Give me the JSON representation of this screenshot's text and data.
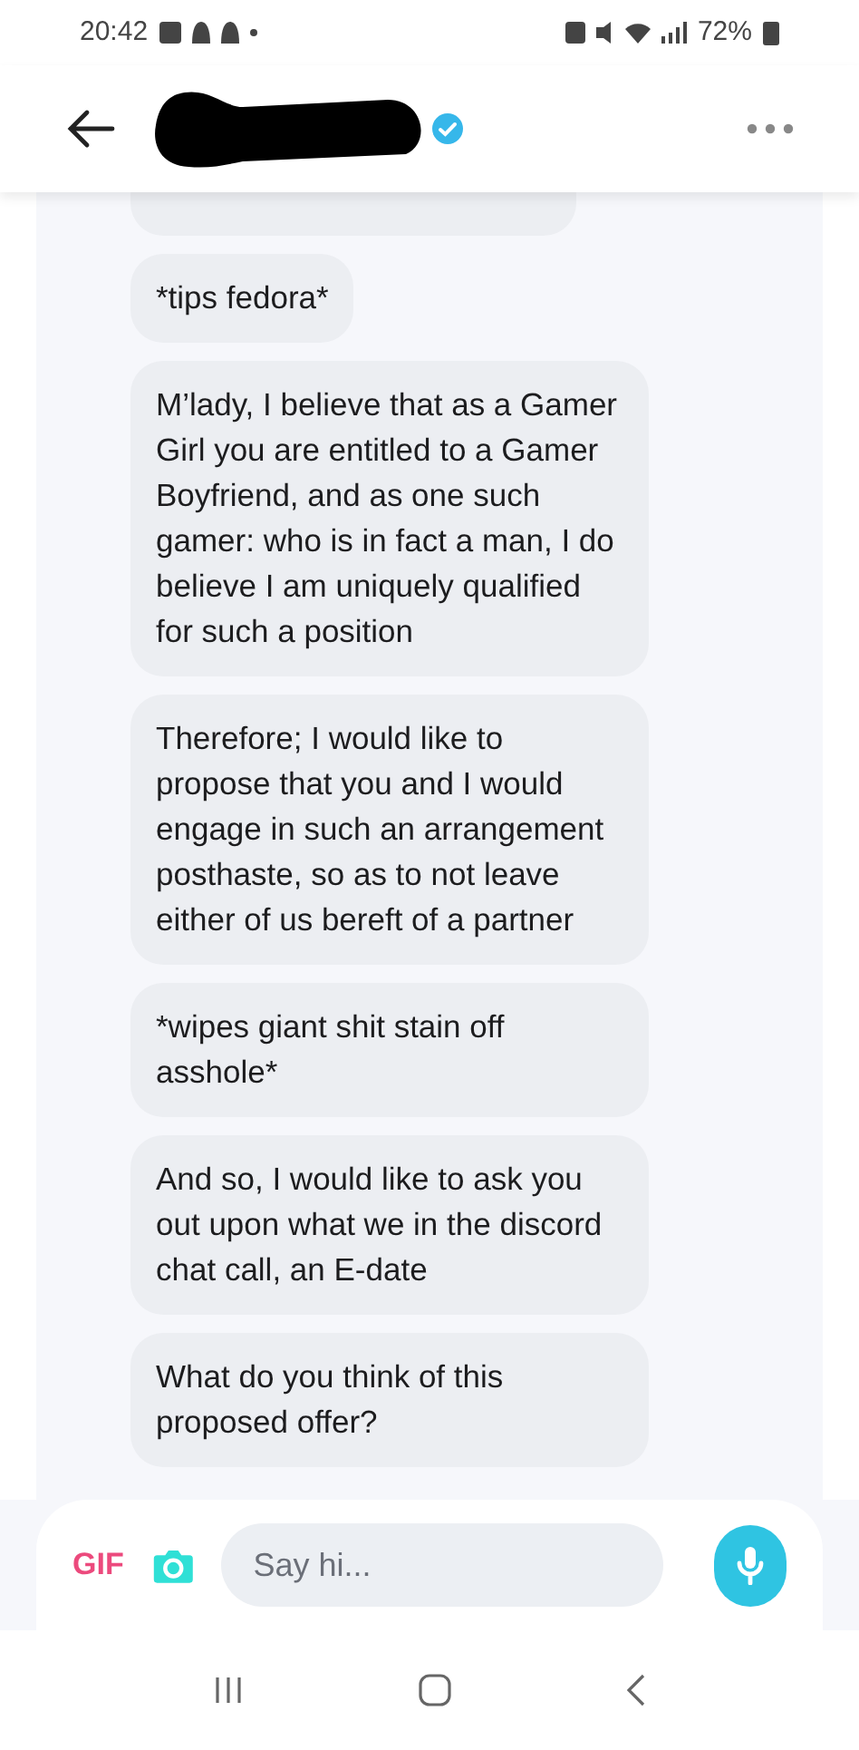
{
  "status_bar": {
    "time": "20:42",
    "battery": "72%"
  },
  "messages": [
    {
      "kind": "cut"
    },
    {
      "kind": "text",
      "text": "*tips fedora*"
    },
    {
      "kind": "text",
      "text": "M’lady, I believe that as a Gamer Girl you are entitled to a Gamer Boyfriend, and as one such gamer: who is in fact a man, I do believe I am uniquely qualified for such a position"
    },
    {
      "kind": "text",
      "text": "Therefore; I would like to propose that you and I would engage in such an arrangement posthaste, so as to not leave either of us bereft of a partner"
    },
    {
      "kind": "text",
      "text": "*wipes giant shit stain off asshole*"
    },
    {
      "kind": "text",
      "text": "And so, I would like to ask you out upon what we in the discord chat call, an E-date"
    },
    {
      "kind": "text",
      "text": "What do you think of this proposed offer?"
    }
  ],
  "composer": {
    "gif": "GIF",
    "placeholder": "Say hi..."
  }
}
